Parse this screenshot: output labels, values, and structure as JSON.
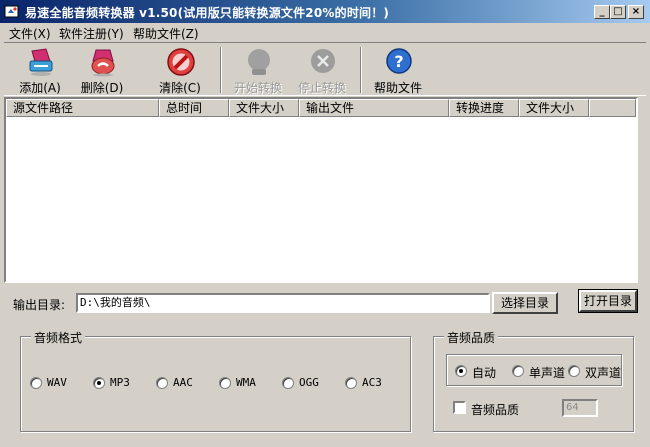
{
  "window": {
    "title": "易速全能音频转换器 v1.50(试用版只能转换源文件20%的时间！)",
    "controls": {
      "minimize": "_",
      "maximize": "□",
      "close": "×"
    }
  },
  "menu": [
    {
      "label": "文件(X)"
    },
    {
      "label": "软件注册(Y)"
    },
    {
      "label": "帮助文件(Z)"
    }
  ],
  "toolbar": [
    {
      "label": "添加(A)",
      "icon": "add-file-icon",
      "enabled": true
    },
    {
      "label": "删除(D)",
      "icon": "delete-icon",
      "enabled": true
    },
    {
      "label": "清除(C)",
      "icon": "clear-icon",
      "enabled": true
    },
    {
      "label": "开始转换",
      "icon": "start-convert-icon",
      "enabled": false
    },
    {
      "label": "停止转换",
      "icon": "stop-convert-icon",
      "enabled": false
    },
    {
      "label": "帮助文件",
      "icon": "help-icon",
      "enabled": true
    }
  ],
  "file_list": {
    "columns": [
      "源文件路径",
      "总时间",
      "文件大小",
      "输出文件",
      "转换进度",
      "文件大小"
    ],
    "rows": []
  },
  "output": {
    "label": "输出目录:",
    "path": "D:\\我的音频\\",
    "select_button": "选择目录",
    "open_button": "打开目录"
  },
  "audio_format": {
    "title": "音频格式",
    "options": [
      "WAV",
      "MP3",
      "AAC",
      "WMA",
      "OGG",
      "AC3"
    ],
    "selected": "MP3"
  },
  "audio_quality": {
    "title": "音频品质",
    "channel_options": [
      "自动",
      "单声道",
      "双声道"
    ],
    "channel_selected": "自动",
    "quality_checkbox_label": "音频品质",
    "quality_checked": false,
    "quality_value": "64"
  }
}
